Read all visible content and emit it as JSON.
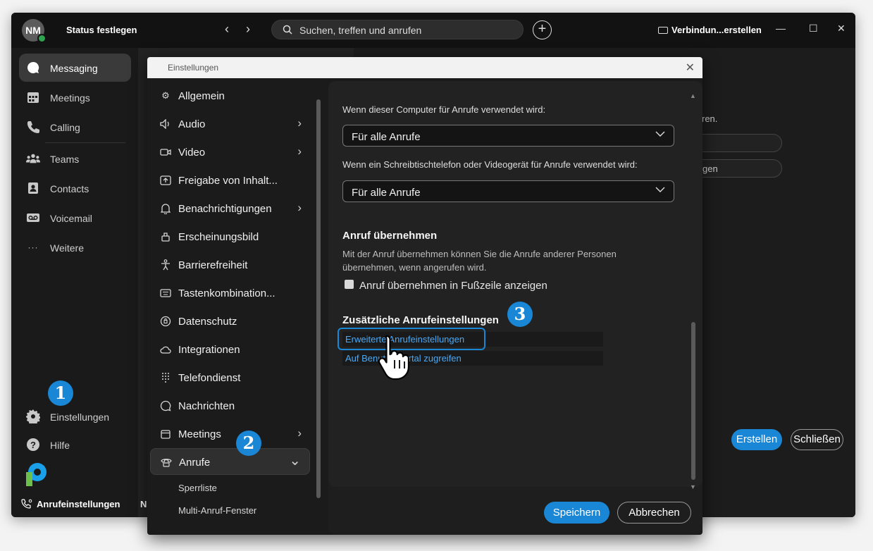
{
  "titlebar": {
    "avatar_initials": "NM",
    "status_label": "Status festlegen",
    "back_arrow": "‹",
    "forward_arrow": "›",
    "search_placeholder": "Suchen, treffen und anrufen",
    "plus_label": "+",
    "connect_label": "Verbindun...erstellen",
    "minimize": "—",
    "maximize": "☐",
    "close": "✕"
  },
  "sidebar": {
    "items": [
      {
        "label": "Messaging",
        "icon": "chat-icon"
      },
      {
        "label": "Meetings",
        "icon": "calendar-icon"
      },
      {
        "label": "Calling",
        "icon": "phone-icon"
      },
      {
        "label": "Teams",
        "icon": "teams-icon"
      },
      {
        "label": "Contacts",
        "icon": "contacts-icon"
      },
      {
        "label": "Voicemail",
        "icon": "voicemail-icon"
      },
      {
        "label": "Weitere",
        "icon": "more-icon"
      }
    ],
    "settings_label": "Einstellungen",
    "help_label": "Hilfe",
    "footer_call_label": "Anrufeinstellungen",
    "footer_extra": "N"
  },
  "background": {
    "partial_text_1": "ren.",
    "partial_text_2": "gen",
    "create_button": "Erstellen",
    "close_button": "Schließen"
  },
  "dialog": {
    "title": "Einstellungen",
    "close": "✕",
    "categories": [
      {
        "label": "Allgemein",
        "icon": "gear-icon",
        "chevron": ""
      },
      {
        "label": "Audio",
        "icon": "speaker-icon",
        "chevron": "›"
      },
      {
        "label": "Video",
        "icon": "video-icon",
        "chevron": "›"
      },
      {
        "label": "Freigabe von Inhalt...",
        "icon": "share-icon",
        "chevron": ""
      },
      {
        "label": "Benachrichtigungen",
        "icon": "bell-icon",
        "chevron": "›"
      },
      {
        "label": "Erscheinungsbild",
        "icon": "appearance-icon",
        "chevron": ""
      },
      {
        "label": "Barrierefreiheit",
        "icon": "accessibility-icon",
        "chevron": ""
      },
      {
        "label": "Tastenkombination...",
        "icon": "keyboard-icon",
        "chevron": ""
      },
      {
        "label": "Datenschutz",
        "icon": "privacy-icon",
        "chevron": ""
      },
      {
        "label": "Integrationen",
        "icon": "cloud-icon",
        "chevron": ""
      },
      {
        "label": "Telefondienst",
        "icon": "dialpad-icon",
        "chevron": ""
      },
      {
        "label": "Nachrichten",
        "icon": "message-icon",
        "chevron": ""
      },
      {
        "label": "Meetings",
        "icon": "calendar-icon",
        "chevron": "›"
      },
      {
        "label": "Anrufe",
        "icon": "phone-icon",
        "chevron": "⌄"
      }
    ],
    "subitems": [
      "Sperrliste",
      "Multi-Anruf-Fenster"
    ],
    "content": {
      "label_computer": "Wenn dieser Computer für Anrufe verwendet wird:",
      "select_computer": "Für alle Anrufe",
      "label_desk": "Wenn ein Schreibtischtelefon oder Videogerät für Anrufe verwendet wird:",
      "select_desk": "Für alle Anrufe",
      "pickup_heading": "Anruf übernehmen",
      "pickup_desc": "Mit der Anruf übernehmen können Sie die Anrufe anderer Personen übernehmen, wenn angerufen wird.",
      "pickup_checkbox": "Anruf übernehmen in Fußzeile anzeigen",
      "additional_heading": "Zusätzliche Anrufeinstellungen",
      "link_advanced": "Erweiterte Anrufeinstellungen",
      "link_portal": "Auf Benutzerportal zugreifen"
    },
    "save_button": "Speichern",
    "cancel_button": "Abbrechen"
  },
  "annotations": {
    "step1": "1",
    "step2": "2",
    "step3": "3"
  },
  "colors": {
    "accent": "#1a87d6",
    "link": "#4aa8f5",
    "presence": "#2da44e"
  }
}
